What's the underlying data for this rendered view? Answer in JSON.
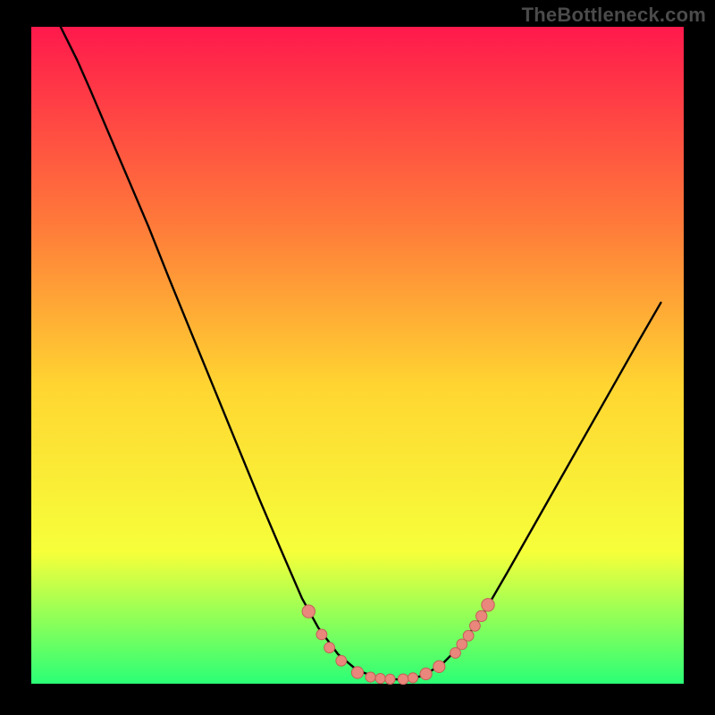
{
  "watermark": "TheBottleneck.com",
  "colors": {
    "background": "#000000",
    "grad_top": "#ff194c",
    "grad_upper_mid": "#ff7a3a",
    "grad_mid": "#ffd631",
    "grad_lower_mid": "#f6ff3a",
    "grad_bottom": "#2bff76",
    "curve": "#000000",
    "dot_fill": "#e9877d",
    "dot_stroke": "#c26056"
  },
  "chart_data": {
    "type": "line",
    "title": "",
    "xlabel": "",
    "ylabel": "",
    "xlim": [
      0,
      100
    ],
    "ylim": [
      0,
      100
    ],
    "note": "Axis values are relative percentages estimated from pixel positions; no numeric tick labels are rendered in the source image.",
    "curve": [
      {
        "x": 4.5,
        "y": 100.0
      },
      {
        "x": 7.0,
        "y": 95.0
      },
      {
        "x": 9.0,
        "y": 90.5
      },
      {
        "x": 12.0,
        "y": 83.5
      },
      {
        "x": 15.0,
        "y": 76.5
      },
      {
        "x": 18.0,
        "y": 69.5
      },
      {
        "x": 21.0,
        "y": 62.0
      },
      {
        "x": 24.5,
        "y": 53.5
      },
      {
        "x": 28.0,
        "y": 45.0
      },
      {
        "x": 31.5,
        "y": 36.5
      },
      {
        "x": 35.0,
        "y": 28.0
      },
      {
        "x": 38.0,
        "y": 21.0
      },
      {
        "x": 41.5,
        "y": 13.0
      },
      {
        "x": 44.0,
        "y": 8.5
      },
      {
        "x": 47.0,
        "y": 4.5
      },
      {
        "x": 50.0,
        "y": 2.0
      },
      {
        "x": 53.5,
        "y": 0.8
      },
      {
        "x": 57.0,
        "y": 0.6
      },
      {
        "x": 60.0,
        "y": 1.2
      },
      {
        "x": 63.0,
        "y": 3.0
      },
      {
        "x": 66.0,
        "y": 6.0
      },
      {
        "x": 69.5,
        "y": 11.0
      },
      {
        "x": 73.0,
        "y": 17.0
      },
      {
        "x": 77.0,
        "y": 24.0
      },
      {
        "x": 81.0,
        "y": 31.0
      },
      {
        "x": 85.0,
        "y": 38.0
      },
      {
        "x": 89.0,
        "y": 45.0
      },
      {
        "x": 93.0,
        "y": 52.0
      },
      {
        "x": 96.5,
        "y": 58.0
      }
    ],
    "markers": [
      {
        "x": 42.5,
        "y": 11.0,
        "r": 1.1
      },
      {
        "x": 44.5,
        "y": 7.5,
        "r": 0.9
      },
      {
        "x": 45.7,
        "y": 5.5,
        "r": 0.9
      },
      {
        "x": 47.5,
        "y": 3.5,
        "r": 0.9
      },
      {
        "x": 50.0,
        "y": 1.7,
        "r": 1.0
      },
      {
        "x": 52.0,
        "y": 1.0,
        "r": 0.85
      },
      {
        "x": 53.5,
        "y": 0.8,
        "r": 0.85
      },
      {
        "x": 55.0,
        "y": 0.7,
        "r": 0.85
      },
      {
        "x": 57.0,
        "y": 0.7,
        "r": 0.9
      },
      {
        "x": 58.5,
        "y": 0.9,
        "r": 0.85
      },
      {
        "x": 60.5,
        "y": 1.5,
        "r": 1.0
      },
      {
        "x": 62.5,
        "y": 2.6,
        "r": 1.0
      },
      {
        "x": 65.0,
        "y": 4.7,
        "r": 0.9
      },
      {
        "x": 66.0,
        "y": 6.0,
        "r": 0.9
      },
      {
        "x": 67.0,
        "y": 7.3,
        "r": 0.9
      },
      {
        "x": 68.0,
        "y": 8.8,
        "r": 0.9
      },
      {
        "x": 69.0,
        "y": 10.3,
        "r": 0.95
      },
      {
        "x": 70.0,
        "y": 12.0,
        "r": 1.1
      }
    ]
  }
}
